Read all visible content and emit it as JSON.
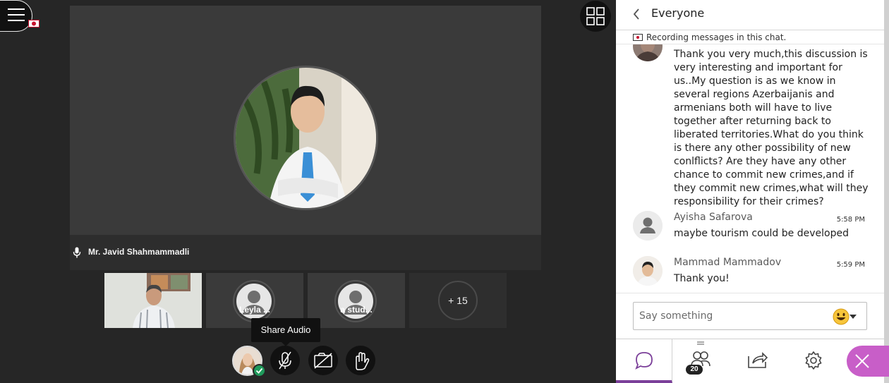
{
  "stage": {
    "speaker_name": "Mr. Javid Shahmammadli",
    "tiles": [
      {
        "label": ""
      },
      {
        "label": "Leyla ..."
      },
      {
        "label": "a stud..."
      }
    ],
    "more_count": "+ 15",
    "tooltip": "Share Audio"
  },
  "panel": {
    "title": "Everyone",
    "recording_note": "Recording messages in this chat.",
    "messages": [
      {
        "author": "",
        "time": "",
        "text": "Thank you very much,this discussion is very interesting and important for us..My question is as we know in several regions Azerbaijanis and armenians both will have to live together after returning back to liberated territories.What do you think is there any other possibility of new conlflicts? Are they have any other chance to commit new crimes,and if they commit new crimes,what will they responsibility for their crimes?"
      },
      {
        "author": "Ayisha Safarova",
        "time": "5:58 PM",
        "text": "maybe tourism could be developed"
      },
      {
        "author": "Mammad Mammadov",
        "time": "5:59 PM",
        "text": "Thank you!"
      }
    ],
    "compose_placeholder": "Say something",
    "attendee_count": "20"
  },
  "colors": {
    "accent": "#7b3f99",
    "close_button": "#c85ec8",
    "stage_bg": "#262626",
    "status_ok": "#1f9a5b",
    "recording": "#c8102e"
  },
  "icons": {
    "menu": "hamburger-icon",
    "grid": "grid-view-icon",
    "mic": "microphone-icon",
    "back": "chevron-left-icon",
    "emoji": "emoji-icon",
    "chat": "chat-icon",
    "attendees": "people-icon",
    "share": "share-content-icon",
    "settings": "gear-icon",
    "close": "close-icon"
  }
}
